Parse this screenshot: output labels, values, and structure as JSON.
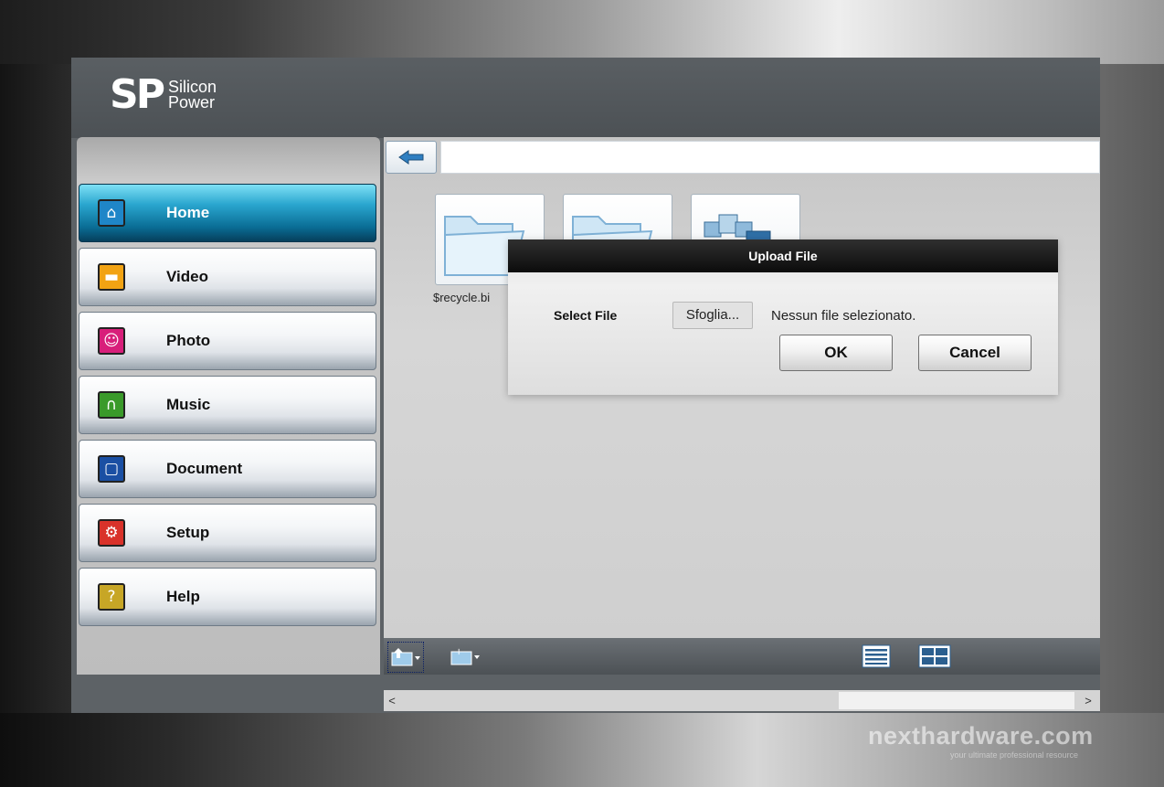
{
  "brand": {
    "logo_mark": "SP",
    "logo_line1": "Silicon",
    "logo_line2": "Power"
  },
  "sidebar": {
    "items": [
      {
        "label": "Home",
        "icon": "home-icon",
        "color": "#1f86c8",
        "active": true
      },
      {
        "label": "Video",
        "icon": "video-icon",
        "color": "#f2a313",
        "active": false
      },
      {
        "label": "Photo",
        "icon": "photo-icon",
        "color": "#d81f7a",
        "active": false
      },
      {
        "label": "Music",
        "icon": "music-icon",
        "color": "#3a9a2a",
        "active": false
      },
      {
        "label": "Document",
        "icon": "document-icon",
        "color": "#1a4fa3",
        "active": false
      },
      {
        "label": "Setup",
        "icon": "setup-icon",
        "color": "#d9322a",
        "active": false
      },
      {
        "label": "Help",
        "icon": "help-icon",
        "color": "#c7a626",
        "active": false
      }
    ]
  },
  "content": {
    "back_icon": "back-arrow-icon",
    "files": [
      {
        "label": "$recycle.bi",
        "icon": "folder-icon"
      },
      {
        "label": "",
        "icon": "folder-icon"
      },
      {
        "label": "",
        "icon": "network-drive-icon"
      }
    ]
  },
  "dialog": {
    "title": "Upload File",
    "select_label": "Select File",
    "browse_label": "Sfoglia...",
    "no_file_text": "Nessun file selezionato.",
    "ok_label": "OK",
    "cancel_label": "Cancel"
  },
  "toolbar": {
    "left_buttons": [
      "upload-folder-icon",
      "new-folder-icon"
    ],
    "right_buttons": [
      "list-view-icon",
      "grid-view-icon"
    ]
  },
  "scrollbar": {
    "left_arrow": "<",
    "right_arrow": ">"
  },
  "watermark": {
    "text": "nexthardware.com",
    "tagline": "your ultimate professional resource"
  }
}
